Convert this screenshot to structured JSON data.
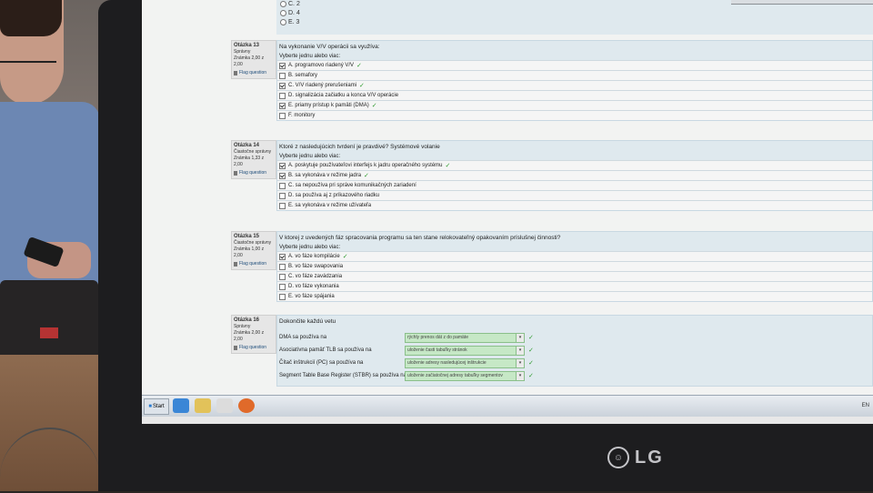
{
  "quiz": {
    "top_options": [
      "C. 2",
      "D. 4",
      "E. 3"
    ],
    "questions": [
      {
        "number_label": "Otázka 13",
        "status": "Správny",
        "score": "Známka 2,00 z 2,00",
        "flag": "Flag question",
        "text": "Na vykonanie V/V operácii sa využíva:",
        "prompt": "Vyberte jednu alebo viac:",
        "answers": [
          {
            "text": "A. programovo riadený V/V",
            "checked": true,
            "correct": true
          },
          {
            "text": "B. semafory",
            "checked": false,
            "correct": false
          },
          {
            "text": "C. V/V riadený prerušeniami",
            "checked": true,
            "correct": true
          },
          {
            "text": "D. signalizácia začiatku a konca V/V operácie",
            "checked": false,
            "correct": false
          },
          {
            "text": "E. priamy prístup k pamäti (DMA)",
            "checked": true,
            "correct": true
          },
          {
            "text": "F. monitory",
            "checked": false,
            "correct": false
          }
        ]
      },
      {
        "number_label": "Otázka 14",
        "status": "Čiastočne správny",
        "score": "Známka 1,33 z 2,00",
        "flag": "Flag question",
        "text": "Ktoré z nasledujúcich tvrdení je pravdivé? Systémové volanie",
        "prompt": "Vyberte jednu alebo viac:",
        "answers": [
          {
            "text": "A. poskytuje používateľovi interfejs k jadru operačného systému",
            "checked": true,
            "correct": true
          },
          {
            "text": "B. sa vykonáva v režime jadra",
            "checked": true,
            "correct": true
          },
          {
            "text": "C. sa nepoužíva pri správe komunikačných zariadení",
            "checked": false,
            "correct": false
          },
          {
            "text": "D. sa používa aj z príkazového riadku",
            "checked": false,
            "correct": false
          },
          {
            "text": "E. sa vykonáva v režime užívateľa",
            "checked": false,
            "correct": false
          }
        ]
      },
      {
        "number_label": "Otázka 15",
        "status": "Čiastočne správny",
        "score": "Známka 1,00 z 2,00",
        "flag": "Flag question",
        "text": "V ktorej z uvedených fáz spracovania programu sa ten stane relokovateľný opakovaním príslušnej činnosti?",
        "prompt": "Vyberte jednu alebo viac:",
        "answers": [
          {
            "text": "A. vo fáze kompilácie",
            "checked": true,
            "correct": true
          },
          {
            "text": "B. vo fáze swapovania",
            "checked": false,
            "correct": false
          },
          {
            "text": "C. vo fáze zavádzania",
            "checked": false,
            "correct": false
          },
          {
            "text": "D. vo fáze vykonania",
            "checked": false,
            "correct": false
          },
          {
            "text": "E. vo fáze spájania",
            "checked": false,
            "correct": false
          }
        ]
      },
      {
        "number_label": "Otázka 16",
        "status": "Správny",
        "score": "Známka 2,00 z 2,00",
        "flag": "Flag question",
        "text": "Dokončite každú vetu",
        "matches": [
          {
            "label": "DMA sa používa na",
            "value": "rýchly prenos dát z do pamäte"
          },
          {
            "label": "Asociatívna pamäť TLB sa používa na",
            "value": "uloženie časti tabuľky stránok"
          },
          {
            "label": "Čítač inštrukcií (PC) sa používa na",
            "value": "uloženie adresy nasledujúcej inštrukcie"
          },
          {
            "label": "Segment Table Base Register (STBR) sa používa na",
            "value": "uloženie začiatočnej adresy tabuľky segmentov"
          }
        ]
      }
    ]
  },
  "taskbar": {
    "start_label": "Start",
    "tray_text": "EN"
  },
  "monitor": {
    "brand": "LG"
  }
}
